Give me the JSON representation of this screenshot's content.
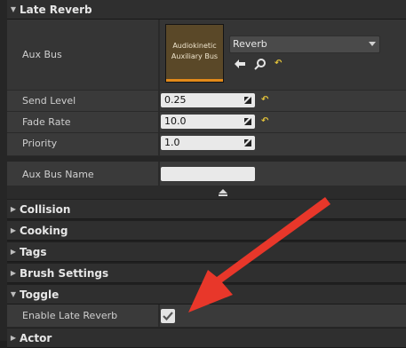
{
  "sections": {
    "late_reverb": "Late Reverb",
    "collision": "Collision",
    "cooking": "Cooking",
    "tags": "Tags",
    "brush_settings": "Brush Settings",
    "toggle": "Toggle",
    "actor": "Actor"
  },
  "aux_bus": {
    "label": "Aux Bus",
    "asset_thumbnail_text": "Audiokinetic Auxiliary Bus",
    "selected": "Reverb"
  },
  "send_level": {
    "label": "Send Level",
    "value": "0.25"
  },
  "fade_rate": {
    "label": "Fade Rate",
    "value": "10.0"
  },
  "priority": {
    "label": "Priority",
    "value": "1.0"
  },
  "aux_bus_name": {
    "label": "Aux Bus Name",
    "value": ""
  },
  "enable_late_reverb": {
    "label": "Enable Late Reverb",
    "checked": true
  },
  "colors": {
    "accent_reset": "#e2c23a",
    "annotation_arrow": "#e8372a",
    "thumb_bar": "#e38a1a"
  },
  "icons": [
    "browse-arrow-icon",
    "search-icon",
    "reset-to-default-icon",
    "advanced-chevron-icon",
    "expand-triangle-icon",
    "checkmark-icon"
  ]
}
